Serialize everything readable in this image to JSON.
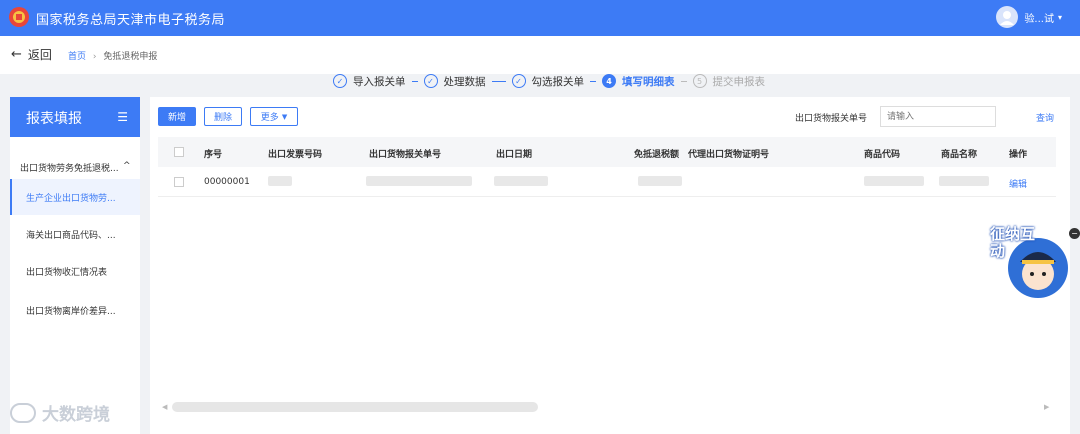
{
  "header": {
    "title": "国家税务总局天津市电子税务局",
    "user_name": "验...试",
    "accent_color": "#3d7bf5"
  },
  "breadcrumb": {
    "back_label": "返回",
    "home": "首页",
    "current": "免抵退税申报"
  },
  "steps": [
    {
      "label": "导入报关单",
      "icon": "✓",
      "state": "done"
    },
    {
      "label": "处理数据",
      "icon": "✓",
      "state": "done"
    },
    {
      "label": "勾选报关单",
      "icon": "✓",
      "state": "done"
    },
    {
      "label": "填写明细表",
      "icon": "4",
      "state": "active"
    },
    {
      "label": "提交申报表",
      "icon": "5",
      "state": "pending"
    }
  ],
  "sidebar": {
    "title": "报表填报",
    "group_label": "出口货物劳务免抵退税...",
    "items": [
      {
        "label": "生产企业出口货物劳..."
      },
      {
        "label": "海关出口商品代码、..."
      },
      {
        "label": "出口货物收汇情况表"
      },
      {
        "label": "出口货物离岸价差异..."
      }
    ]
  },
  "toolbar": {
    "add_label": "新增",
    "delete_label": "删除",
    "more_label": "更多"
  },
  "filter": {
    "label": "出口货物报关单号",
    "placeholder": "请输入",
    "query_label": "查询"
  },
  "table": {
    "headers": [
      "序号",
      "出口发票号码",
      "出口货物报关单号",
      "出口日期",
      "免抵退税额",
      "代理出口货物证明号",
      "商品代码",
      "商品名称",
      "操作"
    ],
    "rows": [
      {
        "index": "00000001",
        "action": "编辑"
      }
    ]
  },
  "mascot": {
    "text": "征纳互动"
  },
  "watermark": {
    "text": "大数跨境"
  }
}
